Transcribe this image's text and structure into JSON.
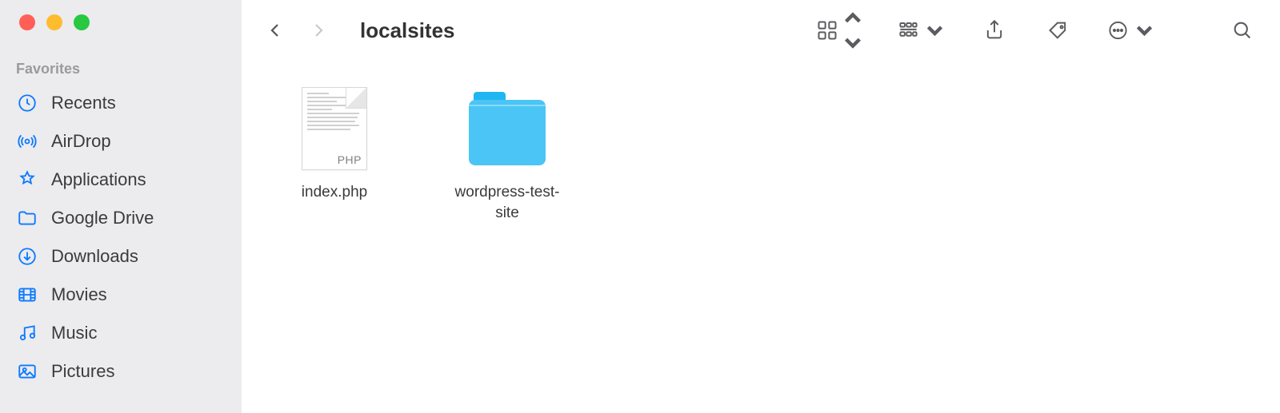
{
  "window": {
    "title": "localsites"
  },
  "sidebar": {
    "section": "Favorites",
    "items": [
      {
        "icon": "clock",
        "label": "Recents"
      },
      {
        "icon": "airdrop",
        "label": "AirDrop"
      },
      {
        "icon": "apps",
        "label": "Applications"
      },
      {
        "icon": "drive",
        "label": "Google Drive"
      },
      {
        "icon": "download",
        "label": "Downloads"
      },
      {
        "icon": "movies",
        "label": "Movies"
      },
      {
        "icon": "music",
        "label": "Music"
      },
      {
        "icon": "pictures",
        "label": "Pictures"
      }
    ]
  },
  "files": [
    {
      "type": "php",
      "name": "index.php",
      "badge": "PHP"
    },
    {
      "type": "folder",
      "name": "wordpress-test-site"
    }
  ]
}
